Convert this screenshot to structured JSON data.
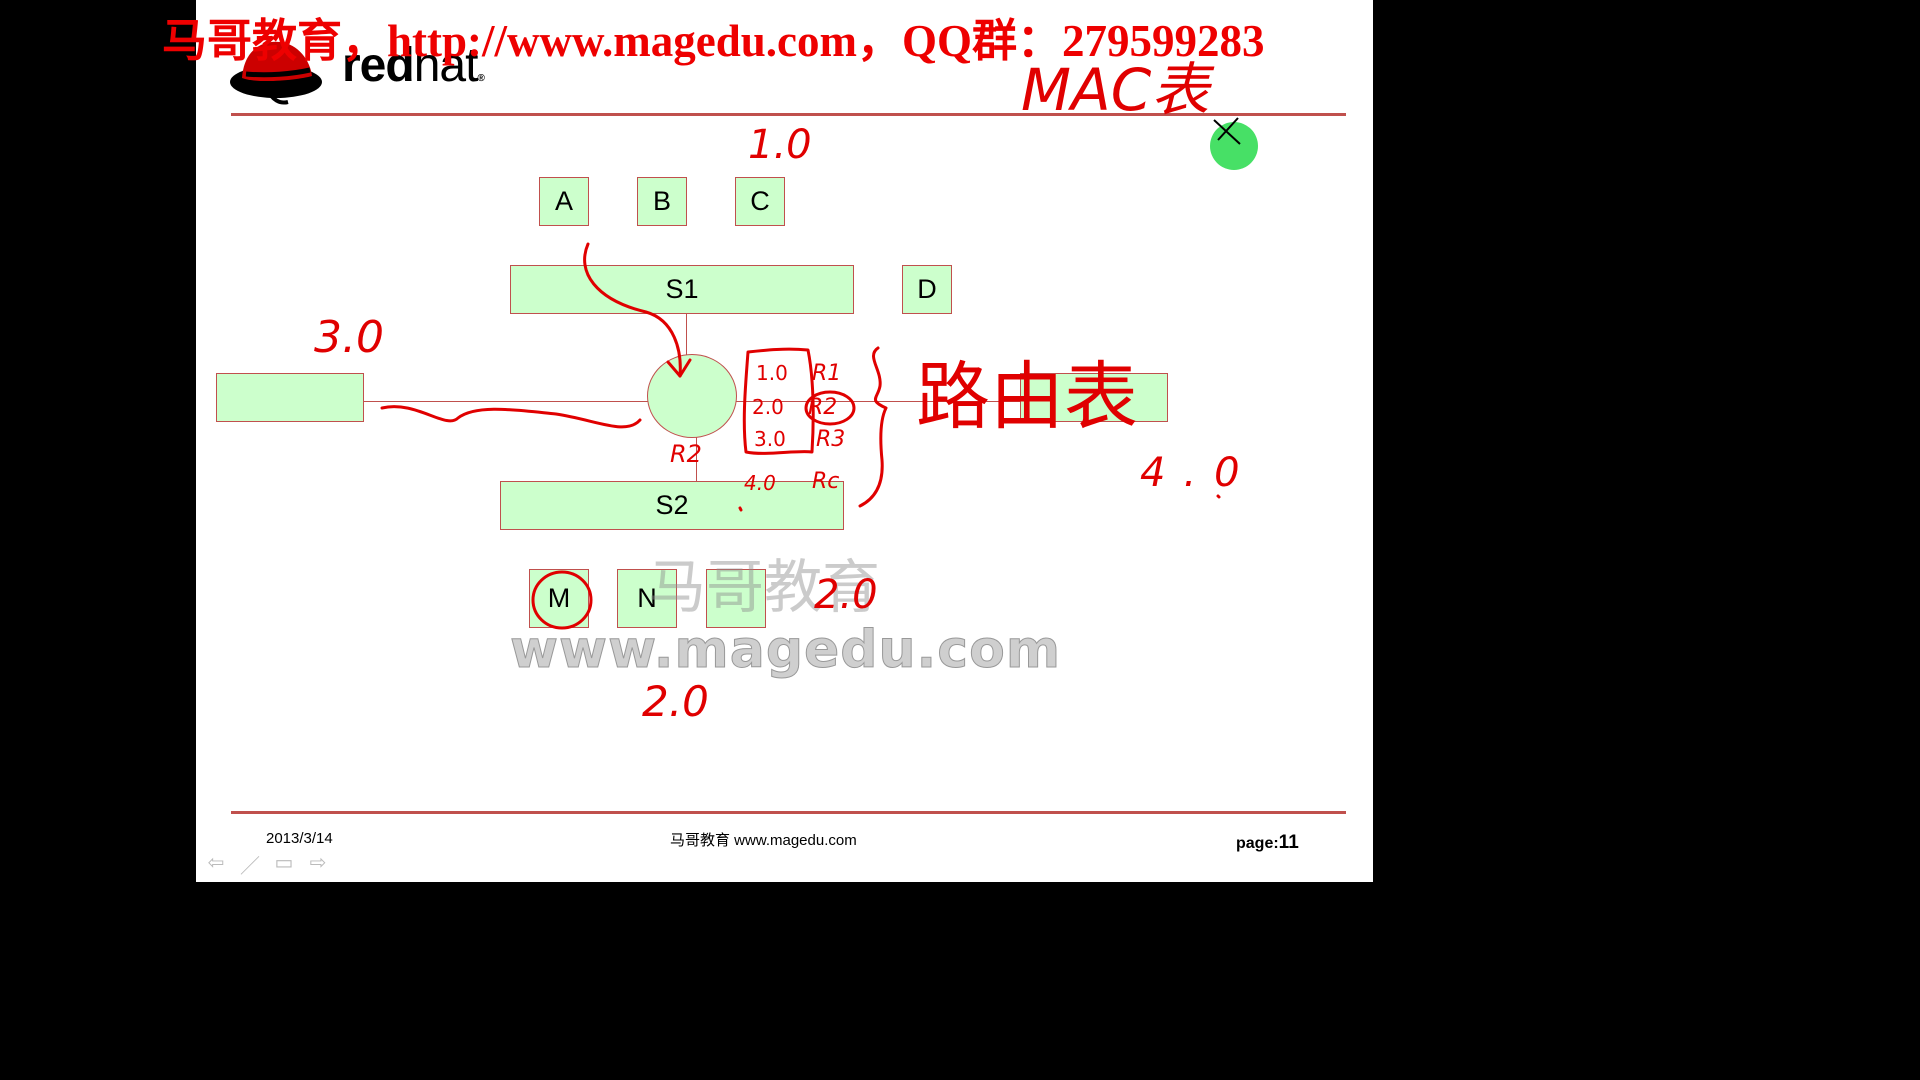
{
  "banner": {
    "text": "马哥教育，http://www.magedu.com，QQ群：279599283"
  },
  "logo": {
    "wordmark_red": "red",
    "wordmark_hat": "hat",
    "icon": "redhat-shadowman-icon"
  },
  "diagram": {
    "hosts_top": [
      "A",
      "B",
      "C"
    ],
    "host_right": "D",
    "switch_top": "S1",
    "switch_bottom": "S2",
    "hosts_bottom": [
      "M",
      "N",
      ""
    ],
    "left_network": "",
    "right_network": ""
  },
  "annotations": {
    "mac_table": "MAC表",
    "network_1": "1.0",
    "network_3": "3.0",
    "network_4": "4.0",
    "network_2_upper": "2.0",
    "network_2_lower": "2.0",
    "router_port": "R2",
    "routing_table_label": "路由表",
    "routing_table": [
      {
        "net": "1.0",
        "iface": "R1"
      },
      {
        "net": "2.0",
        "iface": "R2"
      },
      {
        "net": "3.0",
        "iface": "R3"
      },
      {
        "net": "4.0",
        "iface": "Rc"
      }
    ]
  },
  "watermark": {
    "line1": "马哥教育",
    "line2": "www.magedu.com"
  },
  "footer": {
    "date": "2013/3/14",
    "center": "马哥教育 www.magedu.com",
    "page_label": "page:",
    "page_num": "11"
  },
  "nav": {
    "icons": [
      "back-arrow-icon",
      "pen-icon",
      "menu-icon",
      "forward-arrow-icon"
    ]
  },
  "colors": {
    "accent": "#c0504d",
    "ink": "#e00000",
    "box_fill": "#ccffcc",
    "cursor": "#33dd55"
  }
}
